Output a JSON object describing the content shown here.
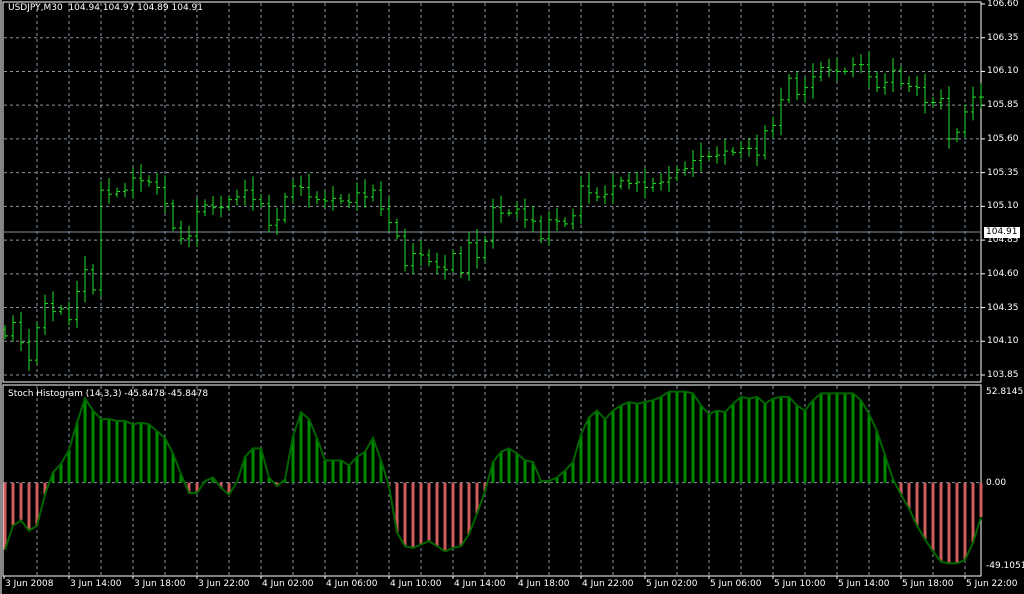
{
  "header": {
    "symbol": "USDJPY,M30",
    "ohlc": "104.94 104.97 104.89 104.91"
  },
  "indicator": {
    "title": "Stoch Histogram (14,3,3) -45.8478 -45.8478",
    "max_label": "52.8145",
    "zero_label": "0.00",
    "min_label": "-49.1051"
  },
  "current_price_label": "104.91",
  "colors": {
    "bar": "#22e022",
    "grid": "#8a96a3",
    "pos_hist": "#008a00",
    "neg_hist": "#cd5c5c",
    "line": "#006400",
    "ask_line": "#8090a0"
  },
  "chart_data": {
    "type": "ohlc",
    "price_axis": {
      "ticks": [
        "106.60",
        "106.35",
        "106.10",
        "105.85",
        "105.60",
        "105.35",
        "105.10",
        "104.85",
        "104.60",
        "104.35",
        "104.10",
        "103.85"
      ],
      "range": [
        103.85,
        106.6
      ]
    },
    "time_labels": [
      "3 Jun 2008",
      "3 Jun 14:00",
      "3 Jun 18:00",
      "3 Jun 22:00",
      "4 Jun 02:00",
      "4 Jun 06:00",
      "4 Jun 10:00",
      "4 Jun 14:00",
      "4 Jun 18:00",
      "4 Jun 22:00",
      "5 Jun 02:00",
      "5 Jun 06:00",
      "5 Jun 10:00",
      "5 Jun 14:00",
      "5 Jun 18:00",
      "5 Jun 22:00"
    ],
    "closes": [
      104.14,
      104.24,
      104.09,
      103.96,
      104.2,
      104.38,
      104.32,
      104.34,
      104.26,
      104.47,
      104.63,
      104.48,
      105.22,
      105.19,
      105.21,
      105.22,
      105.31,
      105.29,
      105.28,
      105.24,
      105.12,
      104.94,
      104.86,
      104.88,
      105.06,
      105.11,
      105.09,
      105.09,
      105.15,
      105.17,
      105.22,
      105.15,
      105.12,
      104.96,
      105.0,
      105.17,
      105.25,
      105.24,
      105.17,
      105.15,
      105.14,
      105.16,
      105.14,
      105.13,
      105.2,
      105.17,
      105.22,
      105.08,
      104.98,
      104.88,
      104.66,
      104.75,
      104.74,
      104.69,
      104.65,
      104.63,
      104.75,
      104.61,
      104.83,
      104.72,
      104.84,
      105.09,
      105.05,
      105.05,
      105.08,
      105.0,
      104.99,
      104.86,
      105.0,
      104.99,
      104.97,
      105.03,
      105.25,
      105.2,
      105.17,
      105.19,
      105.25,
      105.29,
      105.27,
      105.28,
      105.24,
      105.27,
      105.28,
      105.31,
      105.37,
      105.38,
      105.44,
      105.47,
      105.47,
      105.48,
      105.51,
      105.5,
      105.53,
      105.53,
      105.48,
      105.66,
      105.7,
      105.89,
      106.05,
      105.93,
      105.98,
      106.06,
      106.13,
      106.11,
      106.1,
      106.1,
      106.15,
      106.15,
      106.06,
      105.98,
      106.02,
      106.11,
      106.01,
      105.99,
      105.98,
      105.87,
      105.87,
      105.9,
      105.6,
      105.65,
      105.8,
      105.91,
      105.91
    ],
    "stoch_range": [
      -49.1051,
      52.8145
    ],
    "stoch": [
      -39,
      -25,
      -22,
      -28,
      -25,
      -7,
      6,
      11,
      19,
      35,
      49,
      42,
      37,
      37,
      36,
      36,
      34,
      35,
      34,
      30,
      26,
      17,
      5,
      -6,
      -6,
      1,
      3,
      -3,
      -7,
      0.5,
      15,
      20,
      20,
      3,
      -2,
      2,
      27,
      41,
      37,
      26,
      13,
      13,
      13,
      10,
      15,
      18,
      26,
      13,
      -2,
      -29,
      -37,
      -38,
      -36,
      -34,
      -37,
      -40,
      -38,
      -37,
      -30,
      -18,
      -5,
      12,
      18,
      20,
      17,
      13,
      12,
      1,
      1,
      3,
      7,
      12,
      28,
      38,
      42,
      37,
      42,
      45,
      47,
      46,
      47,
      48,
      50,
      53,
      53,
      53,
      52,
      45,
      40,
      42,
      41,
      46,
      50,
      49,
      50,
      46,
      49,
      50,
      50,
      45,
      42,
      48,
      52,
      52,
      52,
      52,
      52,
      48,
      40,
      30,
      16,
      2,
      -7,
      -15,
      -25,
      -33,
      -40,
      -46,
      -47,
      -47,
      -45,
      -35,
      -20
    ]
  }
}
